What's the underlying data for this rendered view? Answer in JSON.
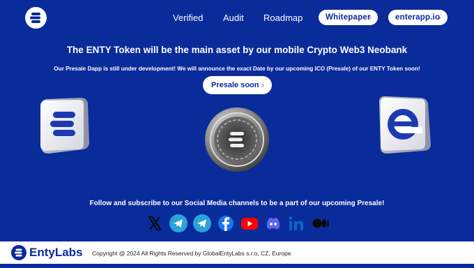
{
  "nav": {
    "links": [
      "Verified",
      "Audit",
      "Roadmap"
    ],
    "whitepaper_label": "Whitepaper",
    "app_label": "enterapp.io"
  },
  "hero": {
    "headline": "The ENTY Token will be the main asset by our mobile Crypto Web3 Neobank",
    "subline": "Our Presale Dapp is still under development!  We will announce the exact Date by our upcoming ICO (Presale) of our ENTY Token soon!",
    "presale_label": "Presale soon"
  },
  "social": {
    "text": "Follow and subscribe to our Social Media channels to be a part of our upcoming Presale!",
    "icons": [
      "x-icon",
      "telegram-icon",
      "telegram-icon",
      "facebook-icon",
      "youtube-icon",
      "discord-icon",
      "linkedin-icon",
      "medium-icon"
    ]
  },
  "footer": {
    "brand": "EntyLabs",
    "copyright": "Copyright @ 2024 All Rights Reserved by GlobalEntyLabs s.r.o, CZ, Europe"
  },
  "colors": {
    "background": "#0a2b9a",
    "text": "#ffffff",
    "telegram": "#2aa3dc",
    "facebook": "#1877f2",
    "youtube": "#ff0000",
    "discord": "#5865f2",
    "linkedin": "#0a66c2"
  }
}
